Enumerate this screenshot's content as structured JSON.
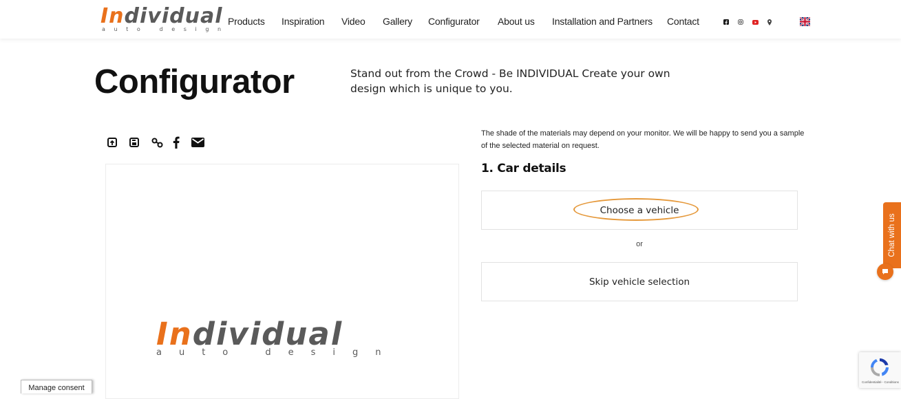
{
  "header": {
    "logo": {
      "text_part1": "In",
      "text_part2": "dividual",
      "tagline": "auto design"
    },
    "nav": [
      {
        "label": "Products"
      },
      {
        "label": "Inspiration"
      },
      {
        "label": "Video"
      },
      {
        "label": "Gallery"
      },
      {
        "label": "Configurator"
      },
      {
        "label": "About us"
      },
      {
        "label": "Installation and Partners"
      },
      {
        "label": "Contact"
      }
    ],
    "social_icons": [
      "facebook-icon",
      "instagram-icon",
      "youtube-icon",
      "location-pin-icon"
    ],
    "language_flag": "uk-flag-icon"
  },
  "page": {
    "title": "Configurator",
    "intro": "Stand out from the Crowd - Be INDIVIDUAL Create your own design which is unique to you."
  },
  "share_toolbar": [
    "upload-icon",
    "save-icon",
    "link-icon",
    "facebook-icon",
    "email-icon"
  ],
  "preview": {
    "logo": {
      "text_part1": "In",
      "text_part2": "dividual",
      "tagline": "auto design"
    }
  },
  "panel": {
    "notice": "The shade of the materials may depend on your monitor. We will be happy to send you a sample of the selected material on request.",
    "section_title": "1. Car details",
    "choose_vehicle_label": "Choose a vehicle",
    "or_label": "or",
    "skip_label": "Skip vehicle selection"
  },
  "chat": {
    "label": "Chat with us"
  },
  "recaptcha": {
    "text": "Confidentialité - Conditions"
  },
  "consent": {
    "label": "Manage consent"
  },
  "colors": {
    "brand_orange": "#e9711c",
    "logo_gray": "#5a5a5a",
    "highlight_ring": "#e5983a",
    "border": "#e2e2e2"
  }
}
